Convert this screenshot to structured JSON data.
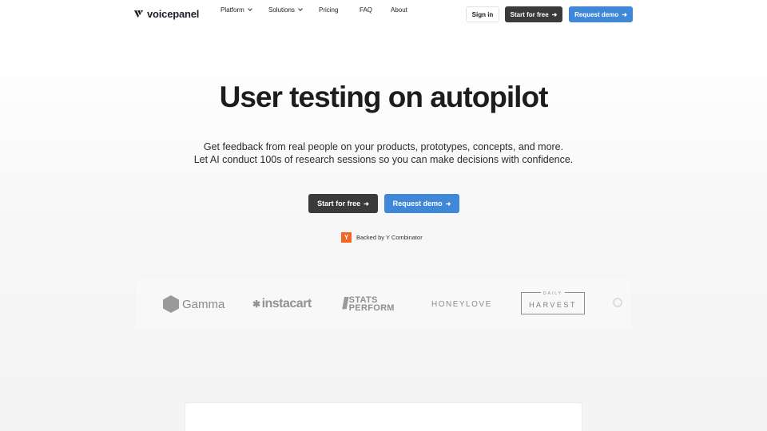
{
  "brand": {
    "name": "voicepanel"
  },
  "nav": {
    "items": [
      {
        "label": "Platform",
        "dropdown": true
      },
      {
        "label": "Solutions",
        "dropdown": true
      },
      {
        "label": "Pricing",
        "dropdown": false
      },
      {
        "label": "FAQ",
        "dropdown": false
      },
      {
        "label": "About",
        "dropdown": false
      }
    ],
    "signin_label": "Sign in",
    "start_label": "Start for free",
    "demo_label": "Request demo"
  },
  "hero": {
    "title": "User testing on autopilot",
    "subtitle_line1": "Get feedback from real people on your products, prototypes, concepts, and more.",
    "subtitle_line2": "Let AI conduct 100s of research sessions so you can make decisions with confidence.",
    "start_label": "Start for free",
    "demo_label": "Request demo",
    "backed_label": "Backed by Y Combinator",
    "yc_letter": "Y"
  },
  "customers": {
    "gamma": "Gamma",
    "instacart": "instacart",
    "stats_line1": "STATS",
    "stats_line2": "PERFORM",
    "honeylove": "HONEYLOVE",
    "harvest_top": "DAILY",
    "harvest_main": "HARVEST"
  },
  "colors": {
    "accent_blue": "#3f87d7",
    "dark_button": "#3a3a3a",
    "yc_orange": "#f26522"
  }
}
